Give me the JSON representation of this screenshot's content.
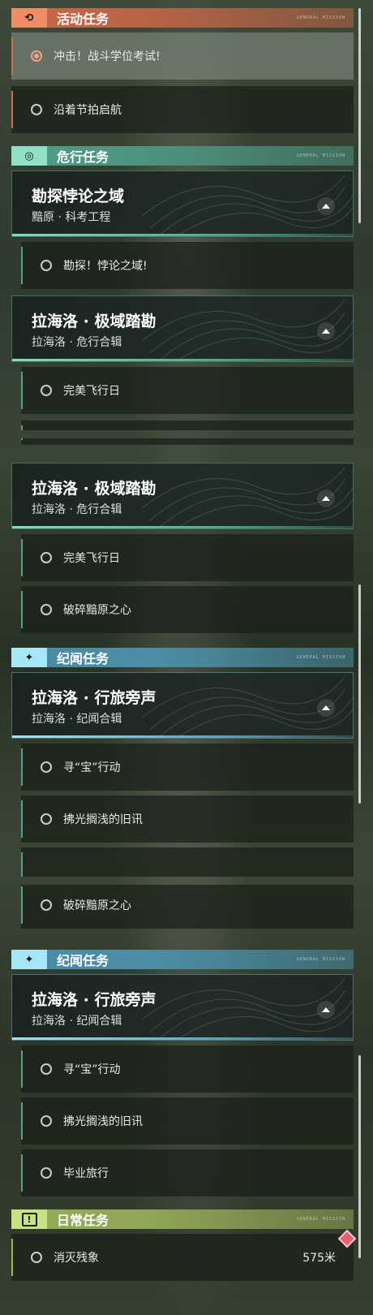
{
  "sections": {
    "activity": {
      "title": "活动任务",
      "tag": "GENERAL MISSION"
    },
    "danger": {
      "title": "危行任务",
      "tag": "GENERAL MISSION"
    },
    "lore": {
      "title": "纪闻任务",
      "tag": "GENERAL MISSION"
    },
    "daily": {
      "title": "日常任务",
      "tag": "GENERAL MISSION"
    }
  },
  "quests": {
    "q1": "冲击！战斗学位考试!",
    "q2": "沿着节拍启航",
    "q3": "勘探！悖论之域!",
    "q4": "完美飞行日",
    "q5": "破碎黯原之心",
    "q6": "寻“宝”行动",
    "q7": "拂光搁浅的旧讯",
    "q8": "毕业旅行",
    "q9": "消灭残象"
  },
  "daily_distance": "575米",
  "cards": {
    "c1": {
      "title": "勘探悖论之域",
      "subtitle": "黯原 · 科考工程"
    },
    "c2": {
      "title": "拉海洛 · 极域踏勘",
      "subtitle": "拉海洛 · 危行合辑"
    },
    "c3": {
      "title": "拉海洛 · 行旅旁声",
      "subtitle": "拉海洛 · 纪闻合辑"
    }
  },
  "icons": {
    "activity": "refresh-icon",
    "danger": "radar-icon",
    "lore": "sparkle-icon",
    "daily": "exclamation-icon",
    "expand": "chevron-up-icon",
    "tracker": "diamond-marker-icon"
  },
  "colors": {
    "activity": "#f08c65",
    "danger": "#8fe0c4",
    "lore": "#a6e6f6",
    "daily": "#c6e283",
    "marker": "#e2626f"
  }
}
